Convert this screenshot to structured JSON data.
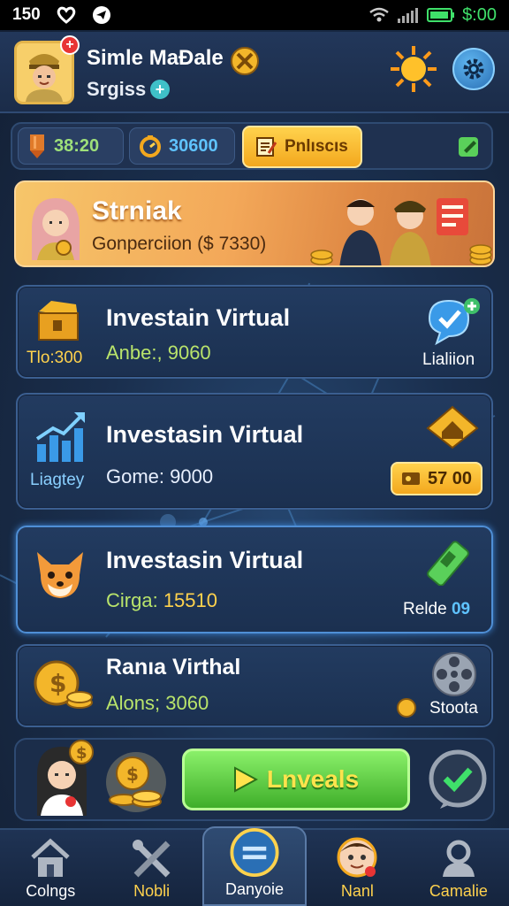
{
  "status": {
    "time": "150",
    "money": "$:00"
  },
  "header": {
    "player_name": "Simle MaĐale",
    "player_sub": "Srgiss"
  },
  "stats": {
    "stat1": "38:20",
    "stat2": "30600",
    "gold_button": "Pnlıscıs"
  },
  "banner": {
    "title": "Strniak",
    "subtitle": "Gonperciion ($ 7330)"
  },
  "cards": [
    {
      "left_label": "Tlo:300",
      "title": "Investain Virtual",
      "value_label": "Anbe:, 9060",
      "right_label": "Lialiion"
    },
    {
      "left_label": "Liagtey",
      "title": "Investasin Virtual",
      "value_label": "Gome: 9000",
      "right_badge": "57 00"
    },
    {
      "title": "Investasin Virtual",
      "value_prefix": "Cirga:",
      "value_num": "15510",
      "right_label": "Relde",
      "right_num": "09"
    },
    {
      "title": "Ranıa Virthal",
      "value_label": "Alons; 3060",
      "right_label": "Stoota"
    }
  ],
  "action": {
    "play_label": "Lnveals"
  },
  "nav": [
    {
      "label": "Colngs",
      "icon": "home-icon"
    },
    {
      "label": "Nobli",
      "icon": "tools-icon"
    },
    {
      "label": "Danyoie",
      "icon": "menu-icon"
    },
    {
      "label": "Nanl",
      "icon": "character-icon"
    },
    {
      "label": "Camalie",
      "icon": "profile-icon"
    }
  ]
}
